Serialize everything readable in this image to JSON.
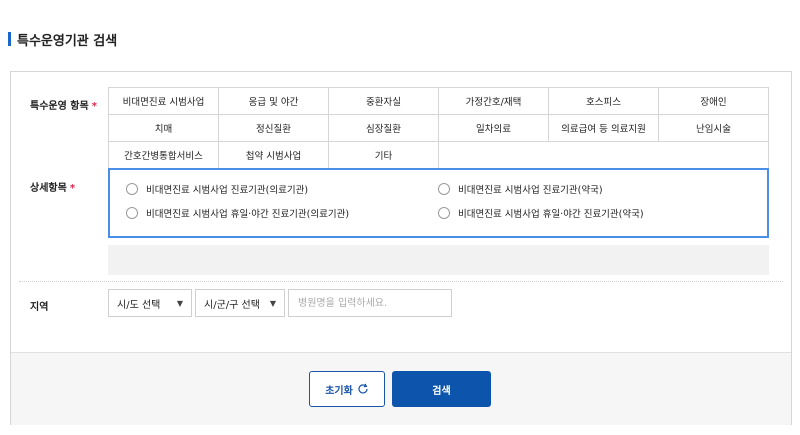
{
  "page": {
    "title": "특수운영기관 검색"
  },
  "form": {
    "category_label": "특수운영 항목",
    "required_mark": "*",
    "categories": [
      "비대면진료 시범사업",
      "응급 및 야간",
      "중환자실",
      "가정간호/재택",
      "호스피스",
      "장애인",
      "치매",
      "정신질환",
      "심장질환",
      "일차의료",
      "의료급여 등 의료지원",
      "난임시술",
      "간호간병통합서비스",
      "첩약 시범사업",
      "기타"
    ],
    "detail_label": "상세항목",
    "detail_options": [
      "비대면진료 시범사업 진료기관(의료기관)",
      "비대면진료 시범사업 진료기관(약국)",
      "비대면진료 시범사업 휴일·야간 진료기관(의료기관)",
      "비대면진료 시범사업 휴일·야간 진료기관(약국)"
    ],
    "region_label": "지역",
    "sido_select": {
      "value": "시/도 선택"
    },
    "sigungu_select": {
      "value": "시/군/구 선택"
    },
    "hospital_input": {
      "value": "",
      "placeholder": "병원명을 입력하세요."
    }
  },
  "buttons": {
    "reset": "초기화",
    "search": "검색"
  },
  "icons": {
    "reset": "refresh-icon",
    "caret": "caret-down-icon"
  },
  "colors": {
    "accent": "#1a66c9",
    "primary_button": "#0d55ac",
    "detail_border": "#4a8ee8",
    "required": "#e0264a"
  }
}
